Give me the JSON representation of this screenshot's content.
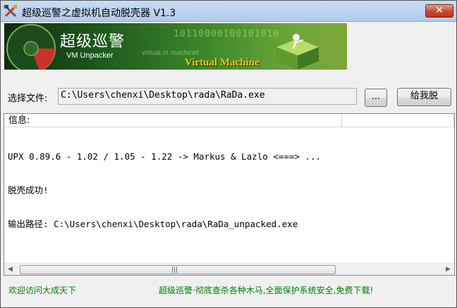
{
  "window": {
    "title": "超级巡警之虚拟机自动脱壳器 V1.3",
    "close_label": "✕"
  },
  "banner": {
    "brand": "超级巡警",
    "subtitle": "VM Unpacker",
    "binary_text": "10110000100101010",
    "url_text": "virtual.m  machinet",
    "vm_text": "Virtual Machine"
  },
  "file": {
    "label": "选择文件:",
    "value": "C:\\Users\\chenxi\\Desktop\\rada\\RaDa.exe",
    "browse_label": "...",
    "unpack_label": "给我脱"
  },
  "info": {
    "header": "信息:",
    "lines": [
      "UPX 0.89.6 - 1.02 / 1.05 - 1.22 -> Markus & Lazlo <===> ...",
      "脱壳成功!",
      "输出路径: C:\\Users\\chenxi\\Desktop\\rada\\RaDa_unpacked.exe"
    ],
    "scroll_left": "◀",
    "scroll_right": "▶",
    "scroll_grip": "|||"
  },
  "footer": {
    "left": "欢迎访问大成天下",
    "right": "超级巡警·彻底查杀各种木马,全面保护系统安全,免费下载!"
  },
  "colors": {
    "footer_text": "#008000",
    "title_bar": "#b8d0ee",
    "close_button": "#c64933"
  },
  "icons": {
    "app": "crossed-tools-icon",
    "close": "close-icon"
  }
}
